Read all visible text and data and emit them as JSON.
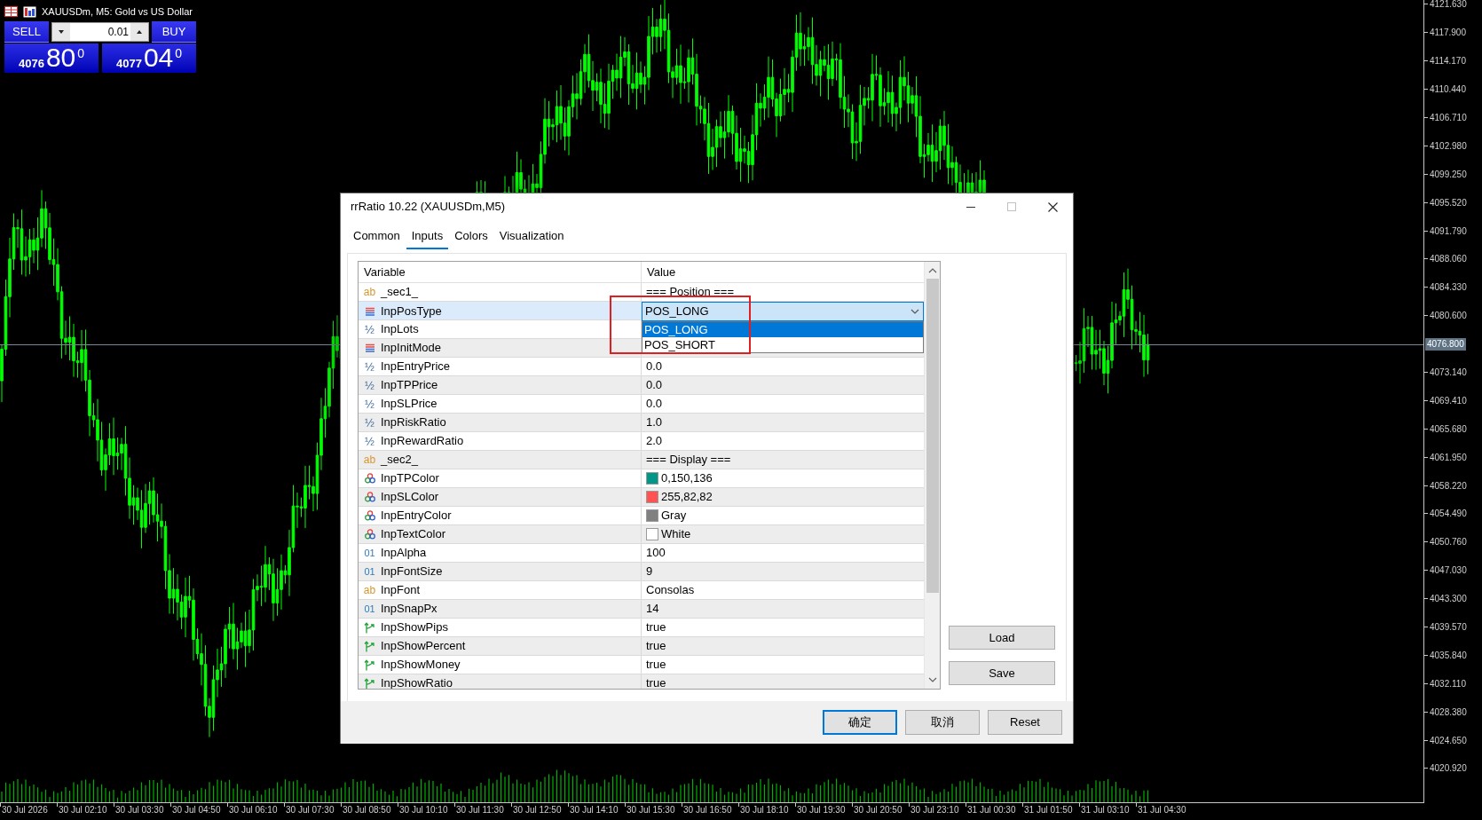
{
  "chart": {
    "symbol_title": "XAUUSDm, M5: Gold vs US Dollar",
    "price_axis_above": [
      "4121.630",
      "4117.900",
      "4114.170",
      "4110.440",
      "4106.710",
      "4102.980",
      "4099.250",
      "4095.520",
      "4091.790",
      "4088.060",
      "4084.330",
      "4080.600"
    ],
    "price_axis_below": [
      "4073.140",
      "4069.410",
      "4065.680",
      "4061.950",
      "4058.220",
      "4054.490",
      "4050.760",
      "4047.030",
      "4043.300",
      "4039.570",
      "4035.840",
      "4032.110",
      "4028.380",
      "4024.650",
      "4020.920"
    ],
    "current_price": "4076.800",
    "time_axis": [
      "30 Jul 2026",
      "30 Jul 02:10",
      "30 Jul 03:30",
      "30 Jul 04:50",
      "30 Jul 06:10",
      "30 Jul 07:30",
      "30 Jul 08:50",
      "30 Jul 10:10",
      "30 Jul 11:30",
      "30 Jul 12:50",
      "30 Jul 14:10",
      "30 Jul 15:30",
      "30 Jul 16:50",
      "30 Jul 18:10",
      "30 Jul 19:30",
      "30 Jul 20:50",
      "30 Jul 23:10",
      "31 Jul 00:30",
      "31 Jul 01:50",
      "31 Jul 03:10",
      "31 Jul 04:30"
    ]
  },
  "trade_panel": {
    "sell_label": "SELL",
    "buy_label": "BUY",
    "lot": "0.01",
    "bid": {
      "big": "4076",
      "pips": "80",
      "point": "0"
    },
    "ask": {
      "big": "4077",
      "pips": "04",
      "point": "0"
    }
  },
  "dialog": {
    "title": "rrRatio 10.22 (XAUUSDm,M5)",
    "tabs": [
      {
        "label": "Common",
        "selected": false
      },
      {
        "label": "Inputs",
        "selected": true
      },
      {
        "label": "Colors",
        "selected": false
      },
      {
        "label": "Visualization",
        "selected": false
      }
    ],
    "table": {
      "columns": [
        "Variable",
        "Value"
      ],
      "rows": [
        {
          "kind": "string",
          "icon": "ab",
          "name": "_sec1_",
          "value": "=== Position ===",
          "selected": false
        },
        {
          "kind": "enum",
          "name": "InpPosType",
          "selected": true,
          "dropdown": {
            "value": "POS_LONG",
            "expanded": true,
            "options": [
              {
                "label": "POS_LONG",
                "selected": true
              },
              {
                "label": "POS_SHORT",
                "selected": false
              }
            ]
          }
        },
        {
          "kind": "double",
          "icon": "½",
          "name": "InpLots",
          "selected": false
        },
        {
          "kind": "enum",
          "name": "InpInitMode",
          "selected": false
        },
        {
          "kind": "double",
          "icon": "½",
          "name": "InpEntryPrice",
          "value": "0.0",
          "selected": false
        },
        {
          "kind": "double",
          "icon": "½",
          "name": "InpTPPrice",
          "value": "0.0",
          "selected": false
        },
        {
          "kind": "double",
          "icon": "½",
          "name": "InpSLPrice",
          "value": "0.0",
          "selected": false
        },
        {
          "kind": "double",
          "icon": "½",
          "name": "InpRiskRatio",
          "value": "1.0",
          "selected": false
        },
        {
          "kind": "double",
          "icon": "½",
          "name": "InpRewardRatio",
          "value": "2.0",
          "selected": false
        },
        {
          "kind": "string",
          "icon": "ab",
          "name": "_sec2_",
          "value": "=== Display ===",
          "selected": false
        },
        {
          "kind": "color",
          "name": "InpTPColor",
          "value": "0,150,136",
          "color": "#009688",
          "selected": false
        },
        {
          "kind": "color",
          "name": "InpSLColor",
          "value": "255,82,82",
          "color": "#ff5252",
          "selected": false
        },
        {
          "kind": "color",
          "name": "InpEntryColor",
          "value": "Gray",
          "color": "#808080",
          "selected": false
        },
        {
          "kind": "color",
          "name": "InpTextColor",
          "value": "White",
          "color": "#ffffff",
          "selected": false
        },
        {
          "kind": "int",
          "icon": "01",
          "name": "InpAlpha",
          "value": "100",
          "selected": false
        },
        {
          "kind": "int",
          "icon": "01",
          "name": "InpFontSize",
          "value": "9",
          "selected": false
        },
        {
          "kind": "string",
          "icon": "ab",
          "name": "InpFont",
          "value": "Consolas",
          "selected": false
        },
        {
          "kind": "int",
          "icon": "01",
          "name": "InpSnapPx",
          "value": "14",
          "selected": false
        },
        {
          "kind": "bool",
          "name": "InpShowPips",
          "value": "true",
          "selected": false
        },
        {
          "kind": "bool",
          "name": "InpShowPercent",
          "value": "true",
          "selected": false
        },
        {
          "kind": "bool",
          "name": "InpShowMoney",
          "value": "true",
          "selected": false
        },
        {
          "kind": "bool",
          "name": "InpShowRatio",
          "value": "true",
          "selected": false
        }
      ]
    },
    "side_buttons": [
      "Load",
      "Save"
    ],
    "buttons": [
      {
        "label": "确定",
        "default": true
      },
      {
        "label": "取消",
        "default": false
      },
      {
        "label": "Reset",
        "default": false
      }
    ]
  }
}
